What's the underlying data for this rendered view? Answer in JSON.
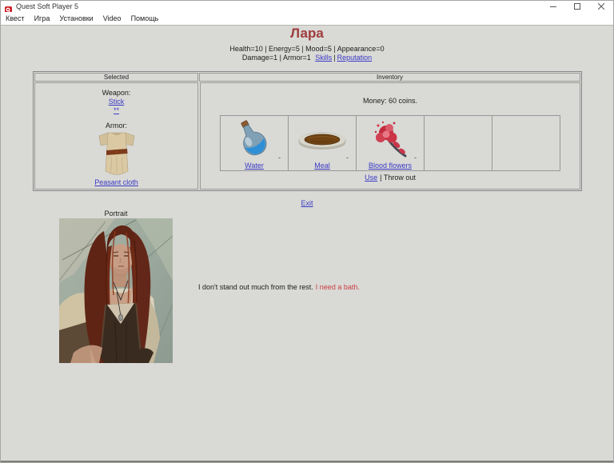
{
  "window": {
    "title": "Quest Soft Player 5"
  },
  "menu": {
    "items": [
      {
        "label": "Квест"
      },
      {
        "label": "Игра"
      },
      {
        "label": "Установки"
      },
      {
        "label": "Video"
      },
      {
        "label": "Помощь"
      }
    ]
  },
  "main": {
    "character_name": "Лара",
    "stats_line1": "Health=10 | Energy=5 | Mood=5 | Appearance=0",
    "stats2": {
      "prefix": "Damage=1 | Armor=1",
      "skills_link": "Skills",
      "sep": "|",
      "reputation_link": "Reputation"
    },
    "exit_link": "Exit"
  },
  "selected": {
    "header": "Selected",
    "weapon_label": "Weapon:",
    "weapon_link": "Stick",
    "weapon_sub_link": "**",
    "armor_label": "Armor:",
    "armor_link": "Peasant cloth"
  },
  "inventory": {
    "header": "Inventory",
    "money_text": "Money: 60 coins.",
    "items": [
      {
        "label": "Water",
        "mark": "-",
        "icon": "water-bottle-icon"
      },
      {
        "label": "Meal",
        "mark": "-",
        "icon": "meal-plate-icon"
      },
      {
        "label": "Blood flowers",
        "mark": "-",
        "icon": "blood-flowers-icon"
      },
      {
        "label": "",
        "mark": "",
        "icon": ""
      },
      {
        "label": "",
        "mark": "",
        "icon": ""
      }
    ],
    "use_link": "Use",
    "rest_actions": "| Throw out"
  },
  "portrait": {
    "label": "Portrait"
  },
  "dialogue": {
    "normal": "I don't stand out much from the rest.",
    "highlight": "I need a bath."
  },
  "colors": {
    "title_red": "#9e3b3b",
    "link_blue": "#3a3ac6",
    "alert_red": "#c94040",
    "background": "#d9d9d6",
    "chrome_white": "#ffffff"
  }
}
